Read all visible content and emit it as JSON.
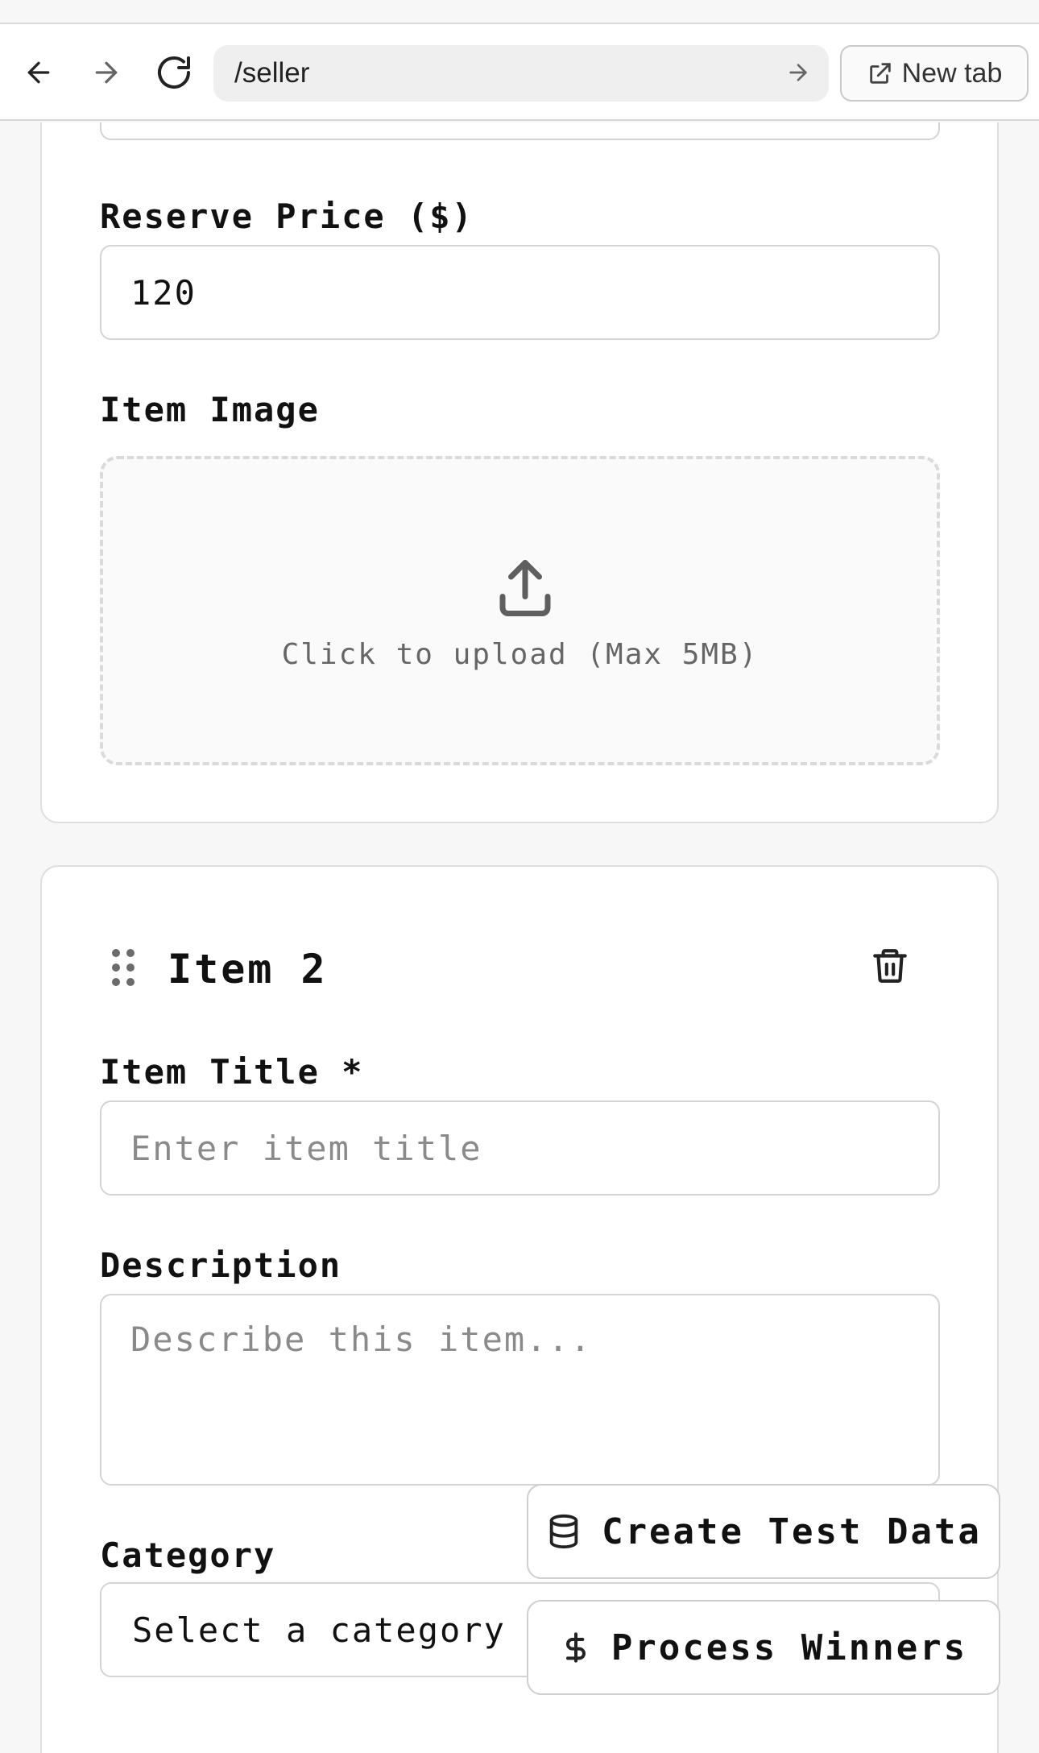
{
  "browser": {
    "back_icon": "arrow-left-icon",
    "forward_icon": "arrow-right-icon",
    "reload_icon": "reload-icon",
    "url": "/seller",
    "go_icon": "arrow-right-icon",
    "new_tab_label": "New tab",
    "new_tab_icon": "external-link-icon"
  },
  "item1": {
    "reserve_price_label": "Reserve Price ($)",
    "reserve_price_value": "120",
    "image_label": "Item Image",
    "upload_icon": "upload-icon",
    "upload_hint": "Click to upload (Max 5MB)"
  },
  "item2": {
    "drag_icon": "drag-handle-icon",
    "title": "Item 2",
    "delete_icon": "trash-icon",
    "title_label": "Item Title *",
    "title_placeholder": "Enter item title",
    "title_value": "",
    "description_label": "Description",
    "description_placeholder": "Describe this item...",
    "description_value": "",
    "category_label": "Category",
    "category_selected": "Select a category"
  },
  "floating_actions": {
    "create_test_data_label": "Create Test Data",
    "create_test_data_icon": "database-icon",
    "process_winners_label": "Process Winners",
    "process_winners_icon": "dollar-icon"
  },
  "colors": {
    "page_background": "#f7f7f7",
    "card_background": "#ffffff",
    "border": "#d4d4d4",
    "placeholder": "#8a8a8a",
    "text": "#111111"
  }
}
